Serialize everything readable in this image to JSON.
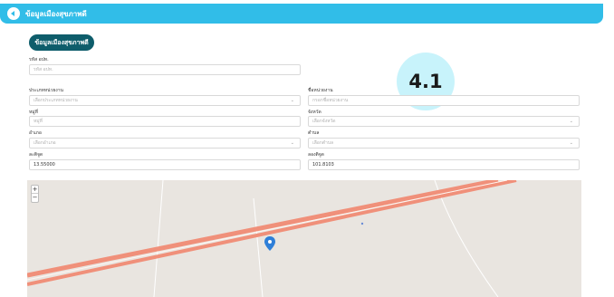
{
  "header": {
    "title": "ข้อมูลเมืองสุขภาพดี"
  },
  "section_button": {
    "label": "ข้อมูลเมืองสุขภาพดี"
  },
  "badge": "4.1",
  "form": {
    "code": {
      "label": "รหัส อปท.",
      "placeholder": "รหัส อปท."
    },
    "org_type": {
      "label": "ประเภทหน่วยงาน",
      "placeholder": "เลือกประเภทหน่วยงาน"
    },
    "org_name": {
      "label": "ชื่อหน่วยงาน",
      "placeholder": "กรอกชื่อหน่วยงาน"
    },
    "village": {
      "label": "หมู่ที่",
      "placeholder": "หมู่ที่"
    },
    "province": {
      "label": "จังหวัด",
      "placeholder": "เลือกจังหวัด"
    },
    "district": {
      "label": "อำเภอ",
      "placeholder": "เลือกอำเภอ"
    },
    "subdistrict": {
      "label": "ตำบล",
      "placeholder": "เลือกตำบล"
    },
    "latitude": {
      "label": "ละติจูด",
      "value": "13.55000"
    },
    "longitude": {
      "label": "ลองติจูด",
      "value": "101.8103"
    }
  },
  "map": {
    "zoom_in": "+",
    "zoom_out": "−",
    "marker_color": "#2f7fd8",
    "road_color": "#f0907a"
  }
}
